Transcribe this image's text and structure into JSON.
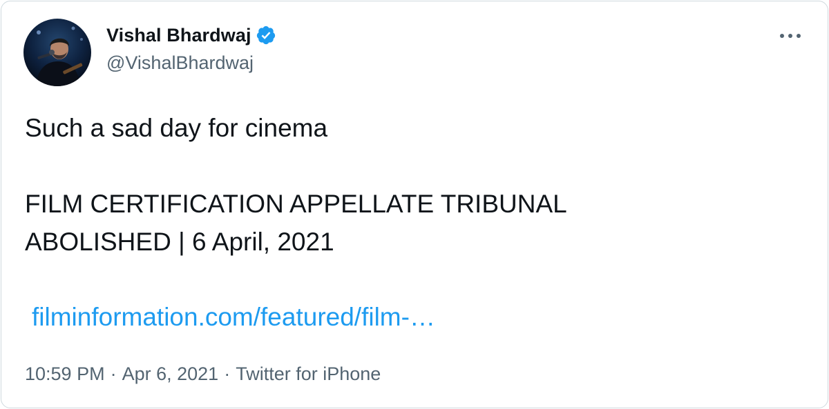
{
  "author": {
    "display_name": "Vishal Bhardwaj",
    "handle": "@VishalBhardwaj",
    "verified": true,
    "avatar_icon": "profile-photo"
  },
  "menu": {
    "more_icon": "ellipsis-icon"
  },
  "tweet": {
    "text": "Such a sad day for cinema\n\nFILM CERTIFICATION APPELLATE TRIBUNAL\nABOLISHED | 6 April, 2021",
    "link": "filminformation.com/featured/film-…"
  },
  "meta": {
    "time": "10:59 PM",
    "date": "Apr 6, 2021",
    "separator": "·",
    "source": "Twitter for iPhone"
  },
  "colors": {
    "link": "#1d9bf0",
    "verified": "#1d9bf0",
    "secondary_text": "#536471",
    "primary_text": "#0f1419",
    "border": "#cfd9de"
  }
}
